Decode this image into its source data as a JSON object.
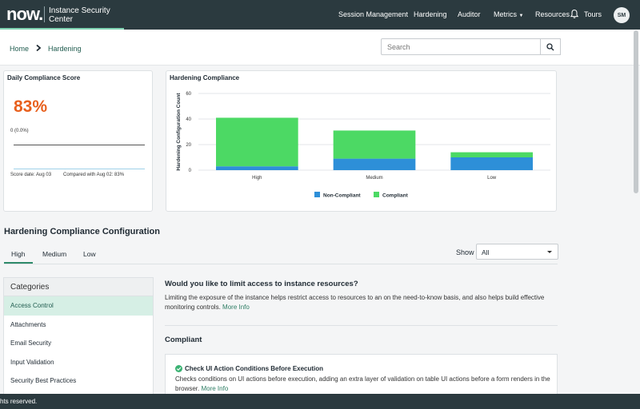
{
  "header": {
    "logo": "now.",
    "app_title": "Instance Security Center",
    "nav": [
      "Session Management",
      "Hardening",
      "Auditor",
      "Metrics",
      "Resources",
      "Tours"
    ],
    "avatar_initials": "SM"
  },
  "breadcrumb": {
    "home": "Home",
    "current": "Hardening"
  },
  "search": {
    "placeholder": "Search"
  },
  "score_card": {
    "title": "Daily Compliance Score",
    "score": "83%",
    "change": "0 (0.0%)",
    "score_date": "Score date: Aug 03",
    "compared": "Compared with Aug 02: 83%"
  },
  "chart_data": {
    "type": "bar",
    "title": "Hardening Compliance",
    "ylabel": "Hardening Configuration Count",
    "xlabel": "",
    "categories": [
      "High",
      "Medium",
      "Low"
    ],
    "series": [
      {
        "name": "Non-Compliant",
        "values": [
          3,
          9,
          10
        ],
        "color": "#2d8fd8"
      },
      {
        "name": "Compliant",
        "values": [
          38,
          22,
          4
        ],
        "color": "#4cd964"
      }
    ],
    "stacked": true,
    "ylim": [
      0,
      60
    ],
    "yticks": [
      0,
      20,
      40,
      60
    ],
    "grid": true,
    "legend": "bottom"
  },
  "config": {
    "title": "Hardening Compliance Configuration",
    "tabs": [
      "High",
      "Medium",
      "Low"
    ],
    "show_label": "Show",
    "show_value": "All",
    "categories_header": "Categories",
    "categories": [
      "Access Control",
      "Attachments",
      "Email Security",
      "Input Validation",
      "Security Best Practices"
    ],
    "question": "Would you like to limit access to instance resources?",
    "description": "Limiting the exposure of the instance helps restrict access to resources to an on the need-to-know basis, and also helps build effective monitoring controls.",
    "more_info": "More Info",
    "compliant_heading": "Compliant",
    "item": {
      "title": "Check UI Action Conditions Before Execution",
      "description": "Checks conditions on UI actions before execution, adding an extra layer of validation on table UI actions before a form renders in the browser.",
      "more_info": "More Info"
    }
  },
  "footer": {
    "text": "hts reserved."
  },
  "colors": {
    "nav_bg": "#2b3a3f",
    "accent": "#7fd2b1",
    "score": "#e85f1c",
    "link": "#2e7d64"
  }
}
